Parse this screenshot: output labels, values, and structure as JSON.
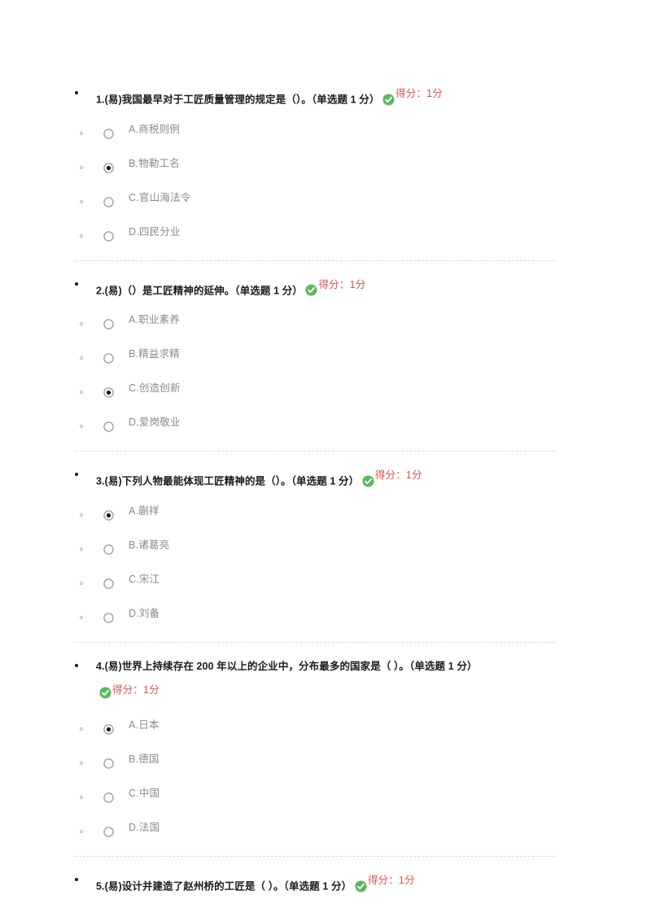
{
  "colors": {
    "page_background": "#ffffff",
    "question_text": "#1a1a1a",
    "option_text": "#8a8a8a",
    "score_text": "#d9534f",
    "check_icon": "#5cb85c",
    "separator": "#d9d9d9",
    "radio_border": "#9a9a9a",
    "radio_dot": "#1a1a1a"
  },
  "score_label": "得分：1分",
  "icons": {
    "check": "check-circle-icon",
    "radio_unchecked": "radio-unchecked-icon",
    "radio_checked": "radio-checked-icon"
  },
  "questions": [
    {
      "number": "1",
      "text": "1.(易)我国最早对于工匠质量管理的规定是（）。（单选题 1 分）",
      "score": "得分：1分",
      "score_inline": true,
      "options": [
        {
          "label": "A.商税则例",
          "selected": false
        },
        {
          "label": "B.物勒工名",
          "selected": true
        },
        {
          "label": "C.官山海法令",
          "selected": false
        },
        {
          "label": "D.四民分业",
          "selected": false
        }
      ]
    },
    {
      "number": "2",
      "text": "2.(易)（）是工匠精神的延伸。（单选题 1 分）",
      "score": "得分：1分",
      "score_inline": true,
      "options": [
        {
          "label": "A.职业素养",
          "selected": false
        },
        {
          "label": "B.精益求精",
          "selected": false
        },
        {
          "label": "C.创造创新",
          "selected": true
        },
        {
          "label": "D.爱岗敬业",
          "selected": false
        }
      ]
    },
    {
      "number": "3",
      "text": "3.(易)下列人物最能体现工匠精神的是（）。（单选题 1 分）",
      "score": "得分：1分",
      "score_inline": true,
      "options": [
        {
          "label": "A.蒯祥",
          "selected": true
        },
        {
          "label": "B.诸葛亮",
          "selected": false
        },
        {
          "label": "C.宋江",
          "selected": false
        },
        {
          "label": "D.刘备",
          "selected": false
        }
      ]
    },
    {
      "number": "4",
      "text": "4.(易)世界上持续存在 200 年以上的企业中，分布最多的国家是（  ）。（单选题 1 分）",
      "score": "得分：1分",
      "score_inline": false,
      "options": [
        {
          "label": "A.日本",
          "selected": true
        },
        {
          "label": "B.德国",
          "selected": false
        },
        {
          "label": "C.中国",
          "selected": false
        },
        {
          "label": "D.法国",
          "selected": false
        }
      ]
    },
    {
      "number": "5",
      "text": "5.(易)设计并建造了赵州桥的工匠是（  ）。（单选题 1 分）",
      "score": "得分：1分",
      "score_inline": true,
      "options": []
    }
  ]
}
